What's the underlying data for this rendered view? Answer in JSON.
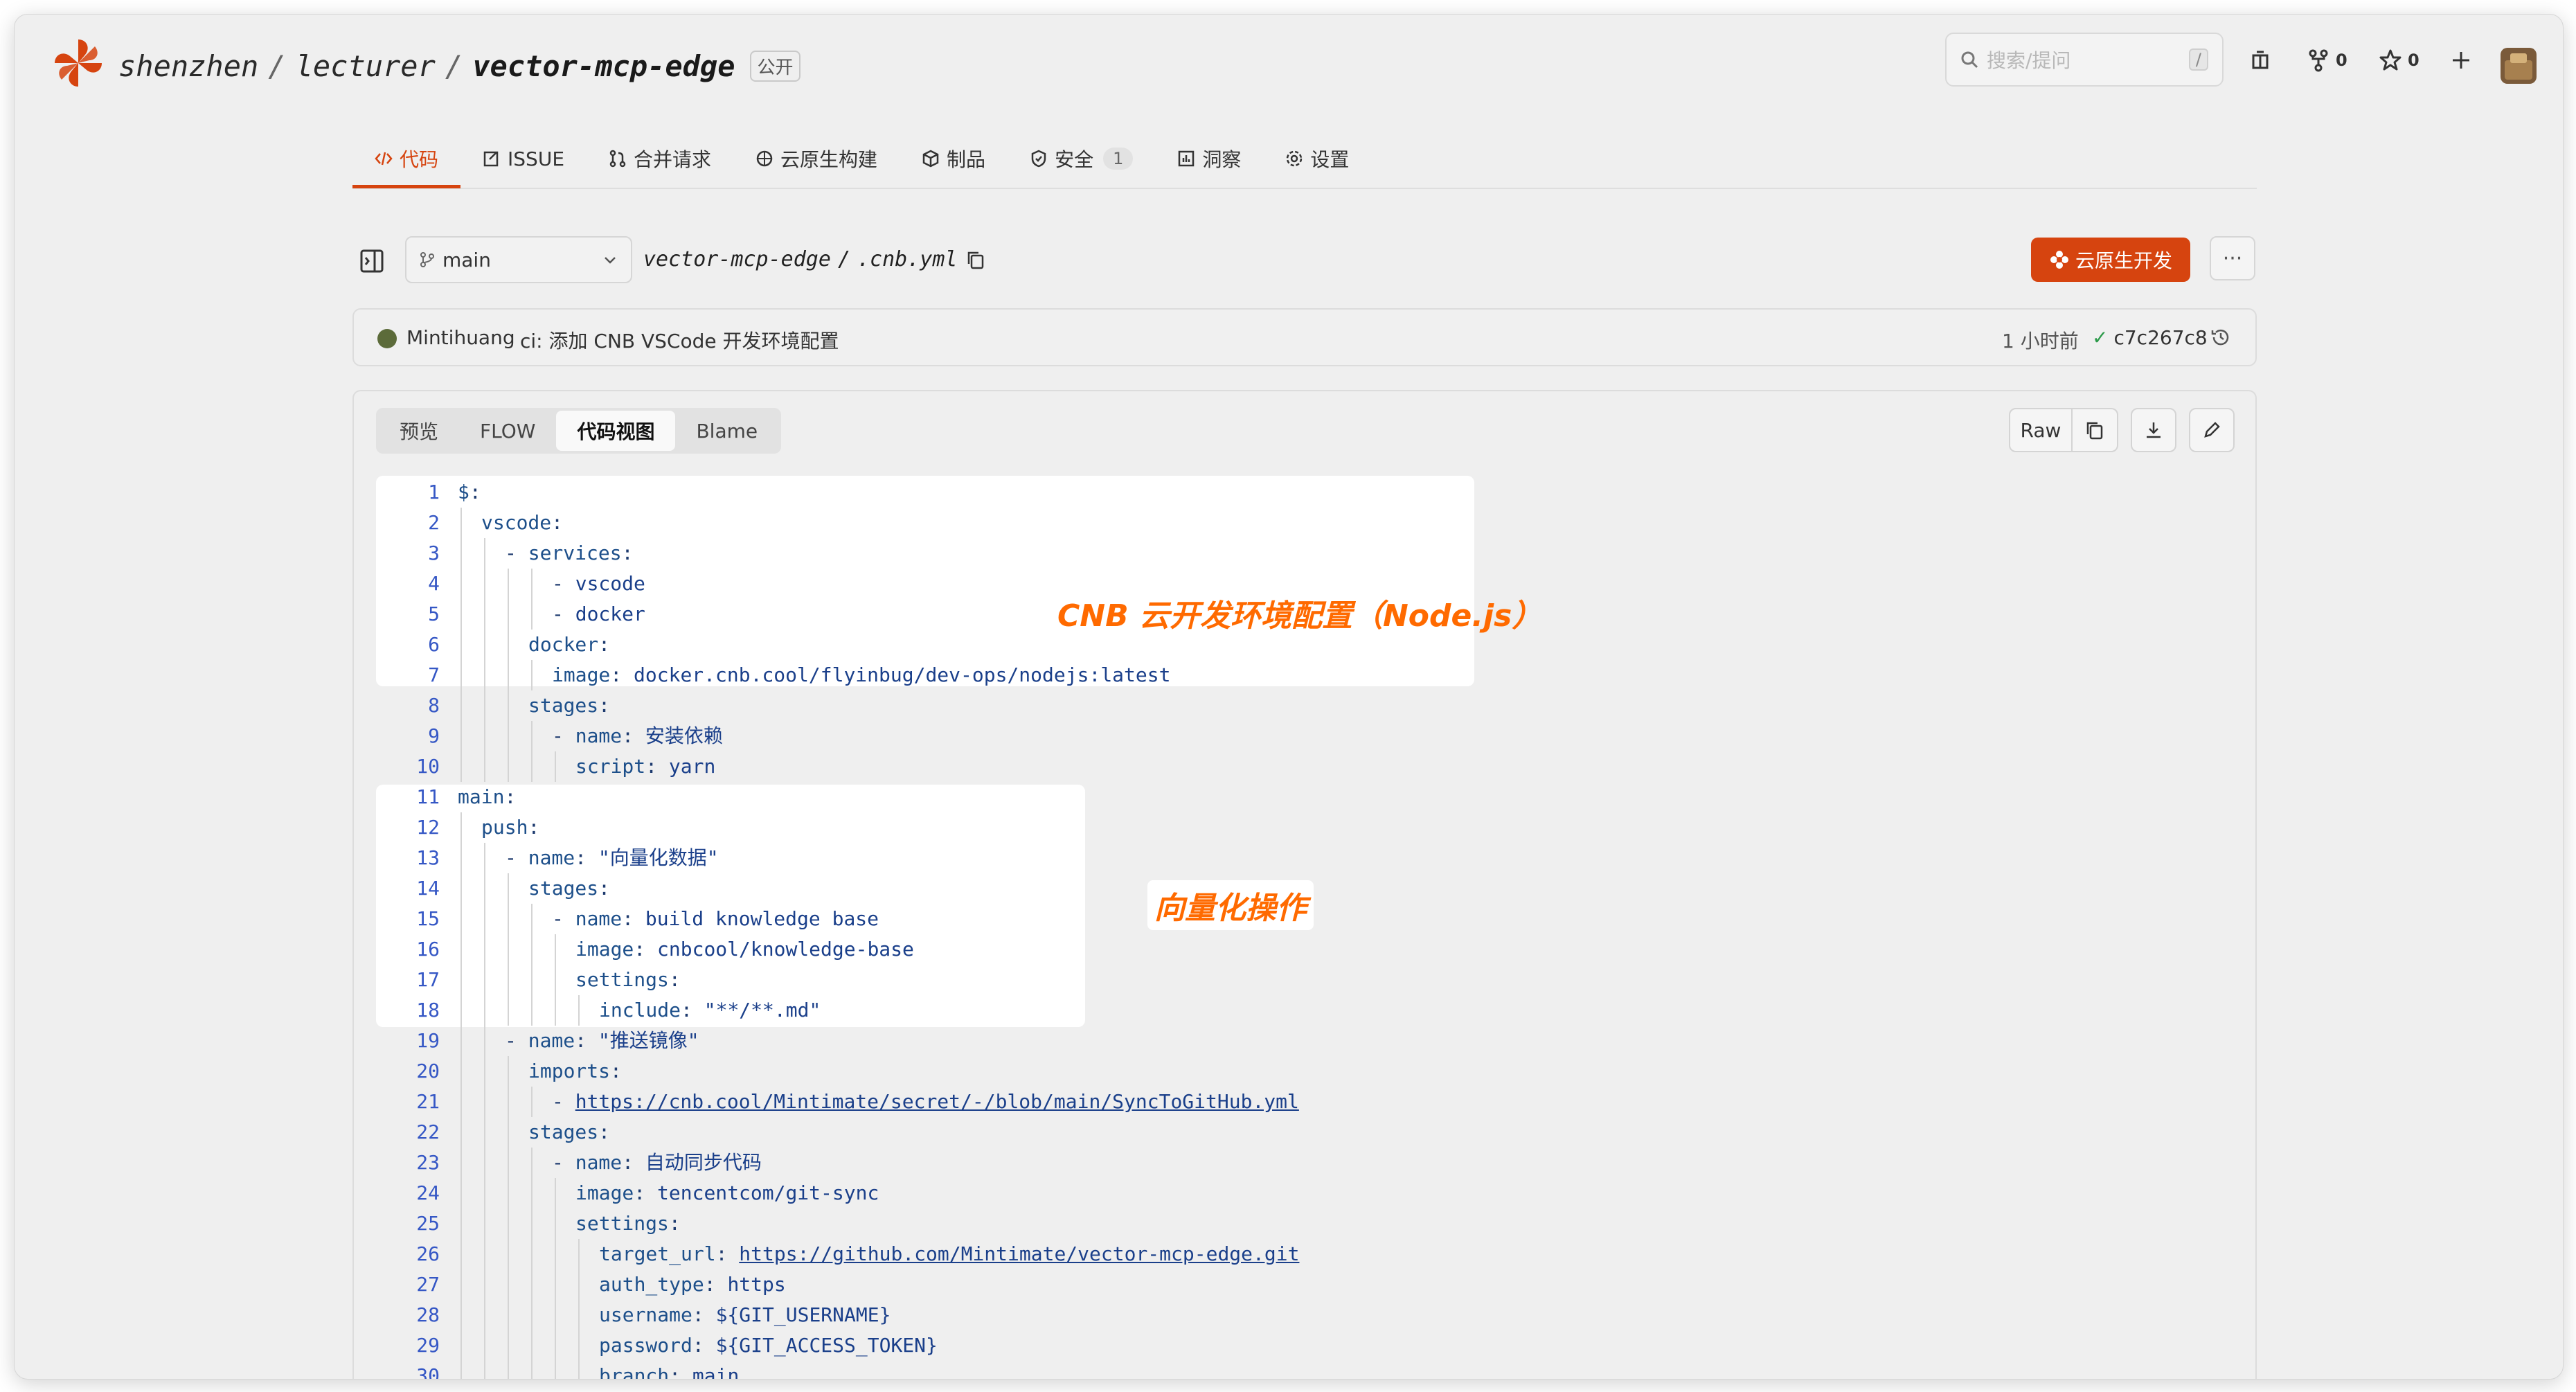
{
  "header": {
    "org": "shenzhen",
    "group": "lecturer",
    "repo": "vector-mcp-edge",
    "visibility": "公开",
    "search_placeholder": "搜索/提问",
    "search_shortcut": "/",
    "fork_count": "0",
    "star_count": "0"
  },
  "tabs": [
    {
      "label": "代码",
      "icon": "code-icon",
      "active": true
    },
    {
      "label": "ISSUE",
      "icon": "issue-icon"
    },
    {
      "label": "合并请求",
      "icon": "merge-icon"
    },
    {
      "label": "云原生构建",
      "icon": "build-icon"
    },
    {
      "label": "制品",
      "icon": "package-icon"
    },
    {
      "label": "安全",
      "icon": "shield-icon",
      "count": "1"
    },
    {
      "label": "洞察",
      "icon": "chart-icon"
    },
    {
      "label": "设置",
      "icon": "gear-icon"
    }
  ],
  "file_bar": {
    "branch": "main",
    "path_repo": "vector-mcp-edge",
    "path_sep": "/",
    "path_file": ".cnb.yml",
    "cloud_dev_label": "云原生开发",
    "more_label": "···"
  },
  "commit": {
    "author": "Mintihuang",
    "message": "ci: 添加 CNB VSCode 开发环境配置",
    "time": "1 小时前",
    "hash": "c7c267c8"
  },
  "view_tabs": [
    {
      "label": "预览"
    },
    {
      "label": "FLOW"
    },
    {
      "label": "代码视图",
      "active": true
    },
    {
      "label": "Blame"
    }
  ],
  "file_actions": {
    "raw_label": "Raw"
  },
  "annotations": {
    "box1": "CNB 云开发环境配置（Node.js）",
    "box2": "向量化操作"
  },
  "colors": {
    "accent": "#d6440f",
    "annotation": "#ff6a00",
    "line_number": "#3557c5"
  },
  "code_lines": [
    {
      "n": "1",
      "indent": 0,
      "key": "$",
      "rest": ":"
    },
    {
      "n": "2",
      "indent": 1,
      "key": "vscode",
      "rest": ":"
    },
    {
      "n": "3",
      "indent": 2,
      "dash": true,
      "key": "services",
      "rest": ":"
    },
    {
      "n": "4",
      "indent": 4,
      "dash": true,
      "value": "vscode"
    },
    {
      "n": "5",
      "indent": 4,
      "dash": true,
      "value": "docker"
    },
    {
      "n": "6",
      "indent": 3,
      "key": "docker",
      "rest": ":"
    },
    {
      "n": "7",
      "indent": 4,
      "key": "image",
      "rest": ": ",
      "value": "docker.cnb.cool/flyinbug/dev-ops/nodejs:latest"
    },
    {
      "n": "8",
      "indent": 3,
      "key": "stages",
      "rest": ":"
    },
    {
      "n": "9",
      "indent": 4,
      "dash": true,
      "key": "name",
      "rest": ": ",
      "value": "安装依赖"
    },
    {
      "n": "10",
      "indent": 5,
      "key": "script",
      "rest": ": ",
      "value": "yarn"
    },
    {
      "n": "11",
      "indent": 0,
      "key": "main",
      "rest": ":"
    },
    {
      "n": "12",
      "indent": 1,
      "key": "push",
      "rest": ":"
    },
    {
      "n": "13",
      "indent": 2,
      "dash": true,
      "key": "name",
      "rest": ": ",
      "value": "\"向量化数据\""
    },
    {
      "n": "14",
      "indent": 3,
      "key": "stages",
      "rest": ":"
    },
    {
      "n": "15",
      "indent": 4,
      "dash": true,
      "key": "name",
      "rest": ": ",
      "value": "build knowledge base"
    },
    {
      "n": "16",
      "indent": 5,
      "key": "image",
      "rest": ": ",
      "value": "cnbcool/knowledge-base"
    },
    {
      "n": "17",
      "indent": 5,
      "key": "settings",
      "rest": ":"
    },
    {
      "n": "18",
      "indent": 6,
      "key": "include",
      "rest": ": ",
      "value": "\"**/**.md\""
    },
    {
      "n": "19",
      "indent": 2,
      "dash": true,
      "key": "name",
      "rest": ": ",
      "value": "\"推送镜像\""
    },
    {
      "n": "20",
      "indent": 3,
      "key": "imports",
      "rest": ":"
    },
    {
      "n": "21",
      "indent": 4,
      "dash": true,
      "link": "https://cnb.cool/Mintimate/secret/-/blob/main/SyncToGitHub.yml"
    },
    {
      "n": "22",
      "indent": 3,
      "key": "stages",
      "rest": ":"
    },
    {
      "n": "23",
      "indent": 4,
      "dash": true,
      "key": "name",
      "rest": ": ",
      "value": "自动同步代码"
    },
    {
      "n": "24",
      "indent": 5,
      "key": "image",
      "rest": ": ",
      "value": "tencentcom/git-sync"
    },
    {
      "n": "25",
      "indent": 5,
      "key": "settings",
      "rest": ":"
    },
    {
      "n": "26",
      "indent": 6,
      "key": "target_url",
      "rest": ": ",
      "link": "https://github.com/Mintimate/vector-mcp-edge.git"
    },
    {
      "n": "27",
      "indent": 6,
      "key": "auth_type",
      "rest": ": ",
      "value": "https"
    },
    {
      "n": "28",
      "indent": 6,
      "key": "username",
      "rest": ": ",
      "value": "${GIT_USERNAME}"
    },
    {
      "n": "29",
      "indent": 6,
      "key": "password",
      "rest": ": ",
      "value": "${GIT_ACCESS_TOKEN}"
    },
    {
      "n": "30",
      "indent": 6,
      "key": "branch",
      "rest": ": ",
      "value": "main"
    }
  ]
}
